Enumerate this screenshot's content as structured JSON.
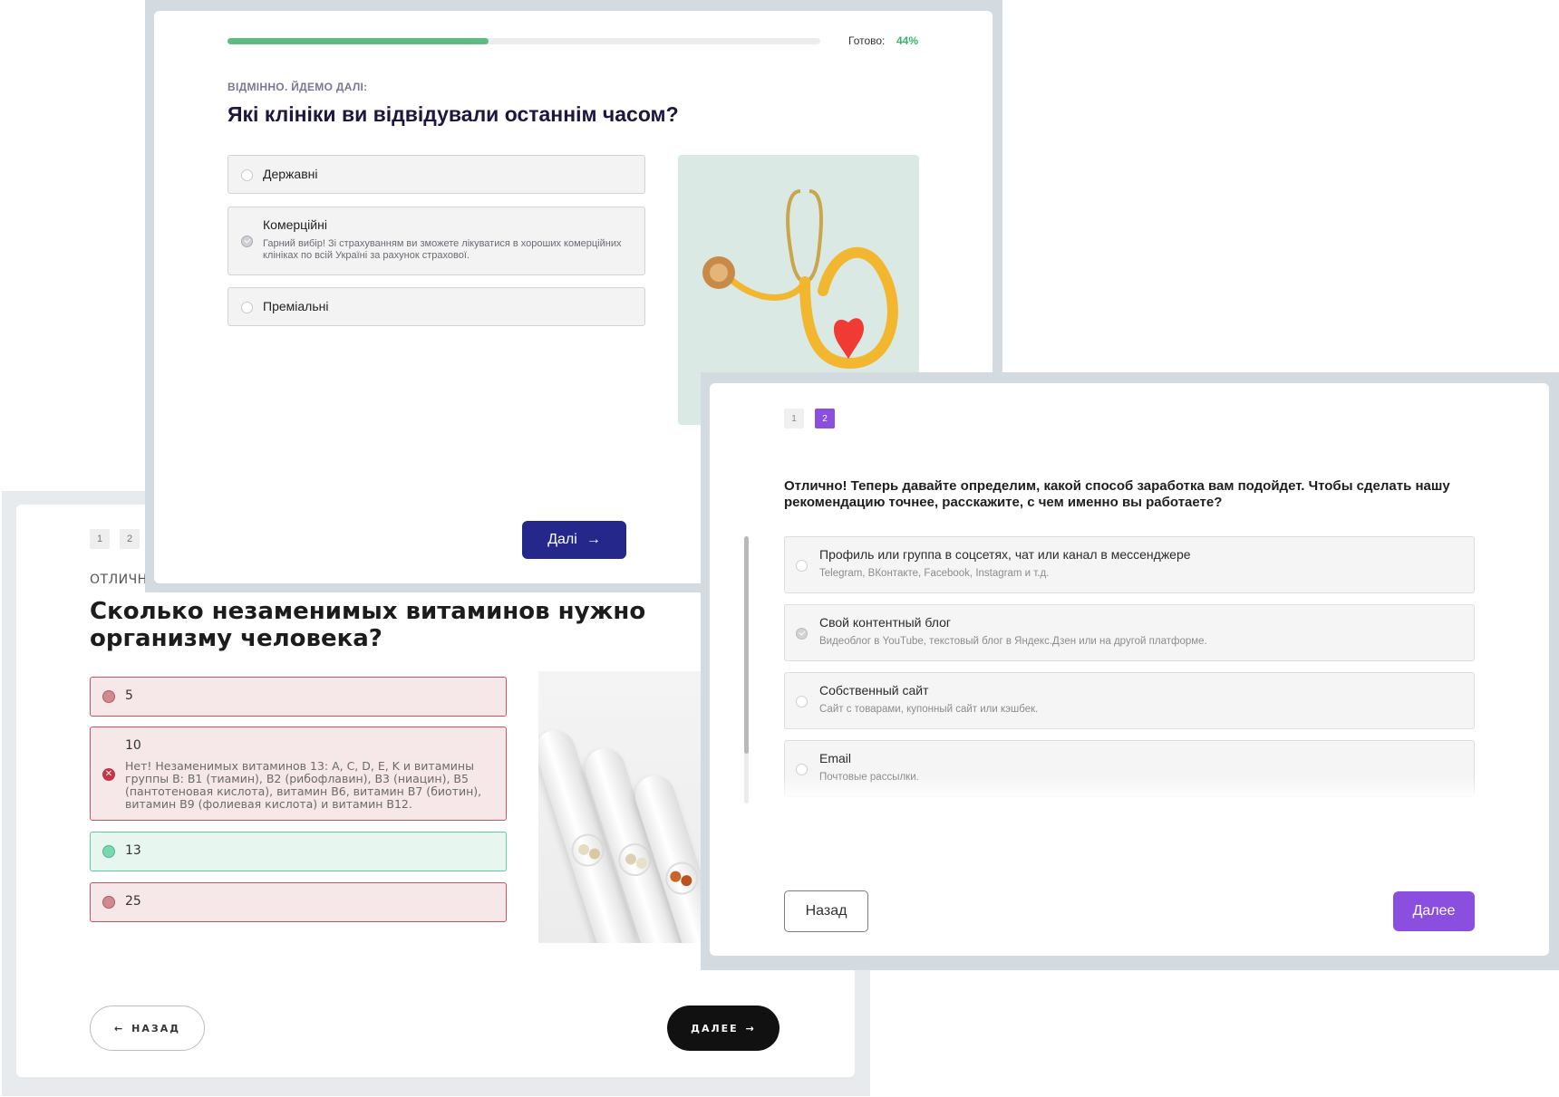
{
  "vitamin_quiz": {
    "steps": [
      "1",
      "2"
    ],
    "kicker": "ОТЛИЧНО",
    "title": "Сколько незаменимых витаминов нужно организму человека?",
    "options": [
      {
        "label": "5",
        "state": "wrong"
      },
      {
        "label": "10",
        "state": "wrong-selected",
        "hint": "Нет! Незаменимых витаминов 13: A, C, D, E, K и витамины группы B: B1 (тиамин), B2 (рибофлавин), B3 (ниацин), B5 (пантотеновая кислота), витамин B6, витамин B7 (биотин), витамин B9 (фолиевая кислота) и витамин B12."
      },
      {
        "label": "13",
        "state": "correct"
      },
      {
        "label": "25",
        "state": "wrong"
      }
    ],
    "back_label": "НАЗАД",
    "next_label": "ДАЛЕЕ",
    "arrow_left": "←",
    "arrow_right": "→"
  },
  "clinic_quiz": {
    "progress_label": "Готово:",
    "progress_value": "44%",
    "progress_fraction": 0.44,
    "kicker": "ВІДМІННО. ЙДЕМО ДАЛІ:",
    "title": "Які клініки ви відвідували останнім часом?",
    "options": [
      {
        "label": "Державні",
        "selected": false
      },
      {
        "label": "Комерційні",
        "selected": true,
        "hint": "Гарний вибір! Зі страхуванням ви зможете лікуватися в хороших комерційних клініках по всій Україні за рахунок страхової."
      },
      {
        "label": "Преміальні",
        "selected": false
      }
    ],
    "next_label": "Далі",
    "next_arrow": "→",
    "image_icon": "stethoscope-heart-photo"
  },
  "income_quiz": {
    "steps": [
      "1",
      "2"
    ],
    "active_step": 2,
    "title": "Отлично! Теперь давайте определим, какой способ заработка вам подойдет. Чтобы сделать нашу рекомендацию точнее, расскажите, с чем именно вы работаете?",
    "options": [
      {
        "label": "Профиль или группа в соцсетях, чат или канал в мессенджере",
        "hint": "Telegram, ВКонтакте, Facebook, Instagram и т.д.",
        "selected": false
      },
      {
        "label": "Свой контентный блог",
        "hint": "Видеоблог в YouTube, текстовый блог в Яндекс.Дзен или на другой платформе.",
        "selected": true
      },
      {
        "label": "Собственный сайт",
        "hint": "Сайт с товарами, купонный сайт или кэшбек.",
        "selected": false
      },
      {
        "label": "Email",
        "hint": "Почтовые рассылки.",
        "selected": false
      }
    ],
    "back_label": "Назад",
    "next_label": "Далее",
    "accent": "#8b4fe0"
  },
  "colors": {
    "clinic_accent": "#25288a",
    "progress_green": "#5dbb83",
    "correct_green": "#5fcf9c",
    "wrong_red": "#c9525c"
  }
}
